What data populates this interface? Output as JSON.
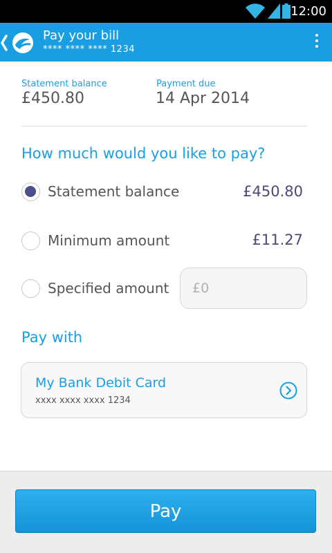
{
  "status_bar": {
    "time": "12:00",
    "icons": [
      "wifi-icon",
      "signal-icon",
      "battery-icon"
    ]
  },
  "app_bar": {
    "title": "Pay your bill",
    "subtitle": "**** **** **** 1234",
    "color": "#1a9ee3"
  },
  "summary": {
    "statement_balance_label": "Statement balance",
    "statement_balance_value": "£450.80",
    "payment_due_label": "Payment due",
    "payment_due_value": "14 Apr 2014"
  },
  "payment_options": {
    "title": "How much would you like to pay?",
    "options": [
      {
        "label": "Statement balance",
        "amount": "£450.80",
        "selected": true
      },
      {
        "label": "Minimum amount",
        "amount": "£11.27",
        "selected": false
      },
      {
        "label": "Specified amount",
        "placeholder": "£0",
        "selected": false
      }
    ]
  },
  "pay_with": {
    "title": "Pay with",
    "card_name": "My Bank Debit Card",
    "card_number": "xxxx xxxx xxxx 1234"
  },
  "actions": {
    "pay_label": "Pay"
  }
}
